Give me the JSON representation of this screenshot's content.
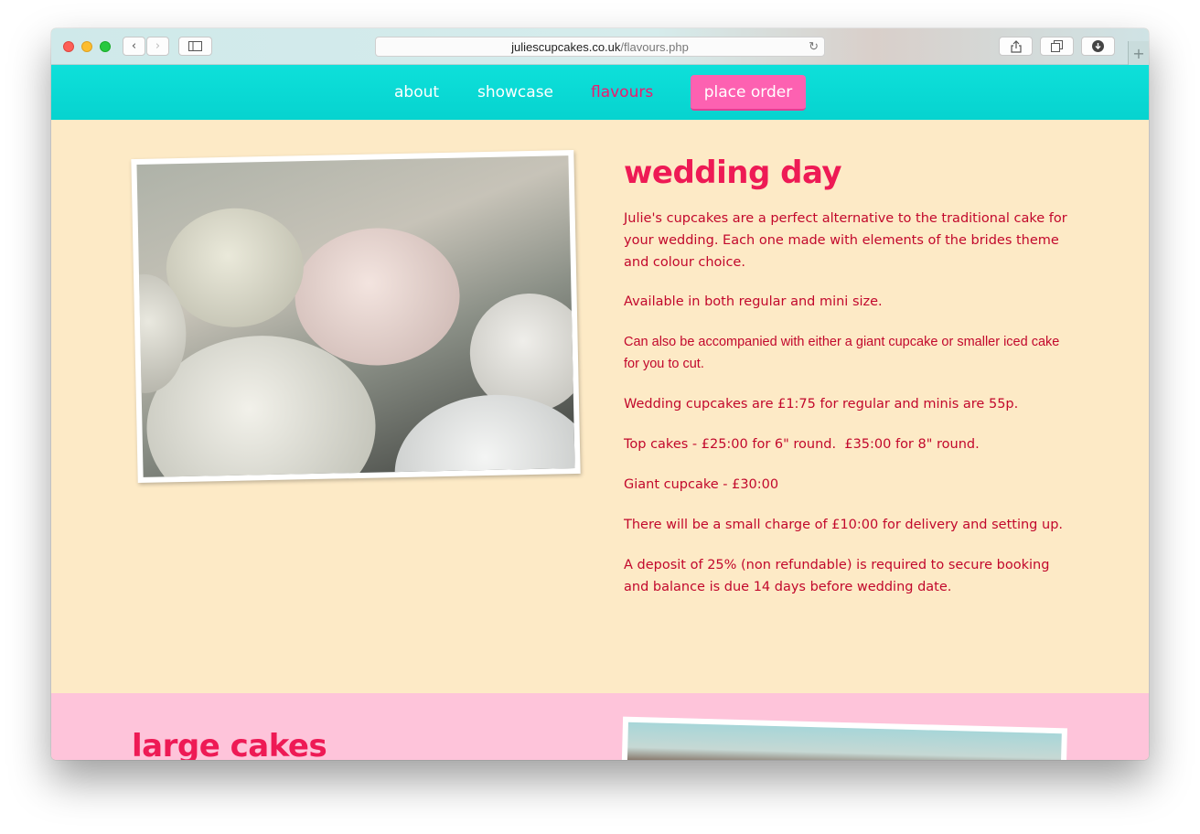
{
  "browser": {
    "url_domain": "juliescupcakes.co.uk",
    "url_path": "/flavours.php"
  },
  "nav": {
    "items": [
      {
        "label": "about"
      },
      {
        "label": "showcase"
      },
      {
        "label": "flavours",
        "active": true
      }
    ],
    "order_button": "place order"
  },
  "wedding": {
    "heading": "wedding day",
    "paragraphs": [
      "Julie's cupcakes are a perfect alternative to the traditional cake for your wedding. Each one made with elements of the brides theme and colour choice.",
      "Available in both regular and mini size.",
      "Can also be accompanied with either a giant cupcake or smaller iced cake for you to cut.",
      "Wedding cupcakes are £1:75 for regular and minis are 55p.",
      "Top cakes - £25:00 for 6\" round.  £35:00 for 8\" round.",
      "Giant cupcake - £30:00",
      "There will be a small charge of £10:00 for delivery and setting up.",
      "A deposit of 25% (non refundable) is required to secure booking and balance is due 14 days before wedding date."
    ]
  },
  "large_cakes": {
    "heading": "large cakes"
  },
  "colors": {
    "nav_bg": "#06d3cf",
    "accent_pink": "#ee1a55",
    "order_button": "#fd61b1",
    "section1_bg": "#fdeac6",
    "section2_bg": "#fec4da",
    "text_red": "#c2082c"
  }
}
